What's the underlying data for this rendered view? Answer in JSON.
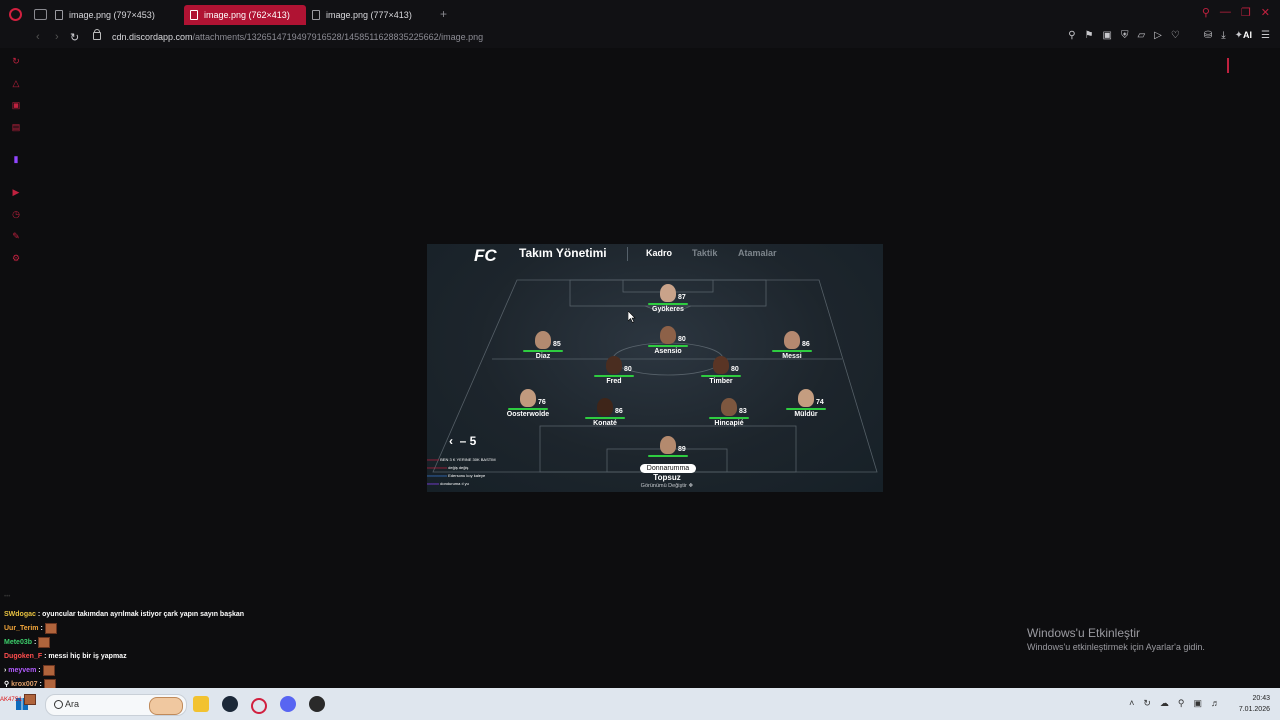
{
  "browser": {
    "tabs": [
      {
        "label": "image.png (797×453)",
        "active": false
      },
      {
        "label": "image.png (762×413)",
        "active": true
      },
      {
        "label": "image.png (777×413)",
        "active": false
      }
    ],
    "new_tab": "+",
    "url_host": "cdn.discordapp.com",
    "url_path": "/attachments/1326514719497916528/1458511628835225662/image.png",
    "ai_label": "AI",
    "accent_color": "#c0213f"
  },
  "sidebar": {
    "items": [
      "history-icon",
      "shopping-icon",
      "messenger-icon",
      "news-icon",
      "twitch-icon",
      "player-icon",
      "clock-icon",
      "pinboard-icon",
      "settings-icon"
    ]
  },
  "game": {
    "logo": "FC",
    "title": "Takım Yönetimi",
    "tabs": [
      "Kadro",
      "Taktik",
      "Atamalar"
    ],
    "formation_nav": "– 5",
    "players": {
      "p1": {
        "name": "Gyökeres",
        "rating": "87"
      },
      "p2": {
        "name": "Asensio",
        "rating": "80"
      },
      "p3": {
        "name": "Diaz",
        "rating": "85"
      },
      "p4": {
        "name": "Messi",
        "rating": "86"
      },
      "p5": {
        "name": "Fred",
        "rating": "80"
      },
      "p6": {
        "name": "Timber",
        "rating": "80"
      },
      "p7": {
        "name": "Oosterwolde",
        "rating": "76"
      },
      "p8": {
        "name": "Konaté",
        "rating": "86"
      },
      "p9": {
        "name": "Hincapié",
        "rating": "83"
      },
      "p10": {
        "name": "Müldür",
        "rating": "74"
      },
      "p11": {
        "name": "Donnarumma",
        "rating": "89"
      }
    },
    "team_name": "Topsuz",
    "change_view": "Görünümü Değiştir",
    "mini_chat": [
      "BEN 3 K YERINE 30K BASTIM",
      "değiş değiş",
      "Edersonu koy kaleye",
      "donduruma ıl yu"
    ]
  },
  "chat": {
    "lines": [
      {
        "user": "SWdogac",
        "text": "oyuncular takımdan ayrılmak istiyor çark yapın sayın başkan",
        "emote": false
      },
      {
        "user": "Uur_Terim",
        "text": "",
        "emote": true
      },
      {
        "user": "Mete03b",
        "text": "",
        "emote": true
      },
      {
        "user": "Dugoken_F",
        "text": "messi hiç bir iş yapmaz",
        "emote": false
      },
      {
        "user": "meyvem",
        "text": "",
        "emote": true
      },
      {
        "user": "krox007",
        "text": "",
        "emote": true
      },
      {
        "user": "AK47S1",
        "text": "",
        "emote": true
      }
    ]
  },
  "activation": {
    "title": "Windows'u Etkinleştir",
    "subtitle": "Windows'u etkinleştirmek için Ayarlar'a gidin."
  },
  "taskbar": {
    "search_placeholder": "Ara",
    "time": "20:43",
    "date": "7.01.2026"
  }
}
